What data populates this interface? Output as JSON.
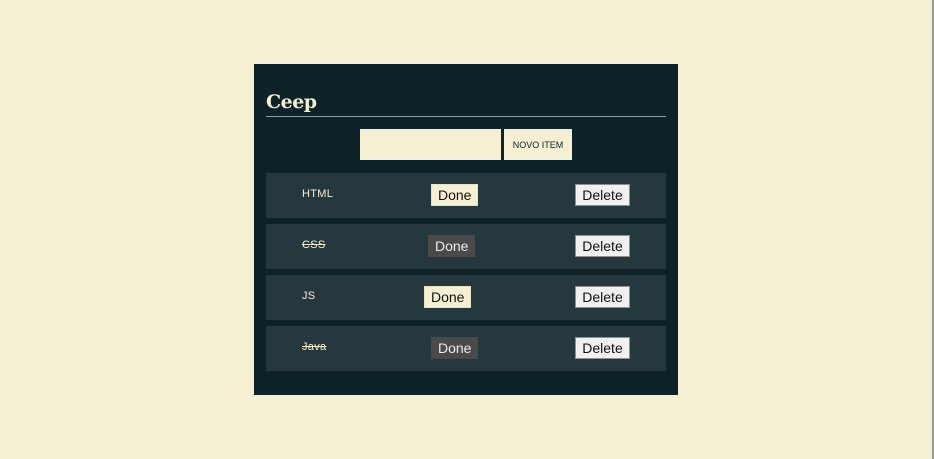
{
  "app": {
    "title": "Ceep"
  },
  "form": {
    "input_value": "",
    "new_button_label": "NOVO ITEM"
  },
  "items": [
    {
      "label": "HTML",
      "done": false,
      "done_label": "Done",
      "delete_label": "Delete"
    },
    {
      "label": "CSS",
      "done": true,
      "done_label": "Done",
      "delete_label": "Delete"
    },
    {
      "label": "JS",
      "done": false,
      "done_label": "Done",
      "delete_label": "Delete"
    },
    {
      "label": "Java",
      "done": true,
      "done_label": "Done",
      "delete_label": "Delete"
    }
  ],
  "colors": {
    "page_background": "#f5f0d3",
    "panel_background": "#0e2229",
    "item_background": "#25383e",
    "accent_cream": "#f5f0d3",
    "done_active": "#4a4a4a"
  }
}
